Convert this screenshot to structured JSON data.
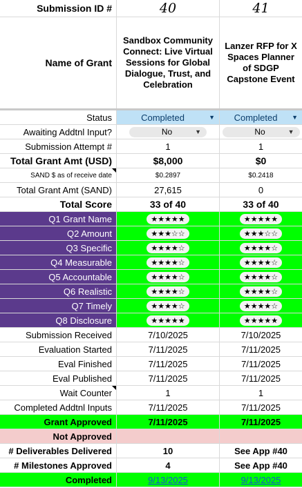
{
  "header": {
    "submission_id_label": "Submission ID #",
    "ids": [
      "40",
      "41"
    ],
    "name_label": "Name of Grant",
    "names": [
      "Sandbox Community Connect: Live Virtual Sessions for Global Dialogue, Trust, and Celebration",
      "Lanzer RFP for X Spaces Planner of SDGP Capstone Event"
    ]
  },
  "rows": {
    "status": {
      "label": "Status",
      "values": [
        "Completed",
        "Completed"
      ]
    },
    "awaiting": {
      "label": "Awaiting Addtnl Input?",
      "values": [
        "No",
        "No"
      ]
    },
    "attempt": {
      "label": "Submission Attempt #",
      "values": [
        "1",
        "1"
      ]
    },
    "total_usd": {
      "label": "Total Grant Amt (USD)",
      "values": [
        "$8,000",
        "$0"
      ]
    },
    "sand_rate": {
      "label": "SAND $ as of receive date",
      "values": [
        "$0.2897",
        "$0.2418"
      ]
    },
    "total_sand": {
      "label": "Total Grant Amt (SAND)",
      "values": [
        "27,615",
        "0"
      ]
    },
    "total_score": {
      "label": "Total Score",
      "values": [
        "33 of 40",
        "33 of 40"
      ]
    }
  },
  "questions": [
    {
      "label": "Q1 Grant Name",
      "values": [
        "★★★★★",
        "★★★★★"
      ]
    },
    {
      "label": "Q2 Amount",
      "values": [
        "★★★☆☆",
        "★★★☆☆"
      ]
    },
    {
      "label": "Q3 Specific",
      "values": [
        "★★★★☆",
        "★★★★☆"
      ]
    },
    {
      "label": "Q4 Measurable",
      "values": [
        "★★★★☆",
        "★★★★☆"
      ]
    },
    {
      "label": "Q5 Accountable",
      "values": [
        "★★★★☆",
        "★★★★☆"
      ]
    },
    {
      "label": "Q6 Realistic",
      "values": [
        "★★★★☆",
        "★★★★☆"
      ]
    },
    {
      "label": "Q7 Timely",
      "values": [
        "★★★★☆",
        "★★★★☆"
      ]
    },
    {
      "label": "Q8 Disclosure",
      "values": [
        "★★★★★",
        "★★★★★"
      ]
    }
  ],
  "dates": {
    "received": {
      "label": "Submission Received",
      "values": [
        "7/10/2025",
        "7/10/2025"
      ]
    },
    "eval_started": {
      "label": "Evaluation Started",
      "values": [
        "7/11/2025",
        "7/11/2025"
      ]
    },
    "eval_finished": {
      "label": "Eval Finished",
      "values": [
        "7/11/2025",
        "7/11/2025"
      ]
    },
    "eval_published": {
      "label": "Eval Published",
      "values": [
        "7/11/2025",
        "7/11/2025"
      ]
    },
    "wait_counter": {
      "label": "Wait Counter",
      "values": [
        "1",
        "1"
      ]
    },
    "completed_inputs": {
      "label": "Completed Addtnl Inputs",
      "values": [
        "7/11/2025",
        "7/11/2025"
      ]
    }
  },
  "outcomes": {
    "approved": {
      "label": "Grant Approved",
      "values": [
        "7/11/2025",
        "7/11/2025"
      ]
    },
    "not_approved": {
      "label": "Not Approved",
      "values": [
        "",
        ""
      ]
    },
    "deliverables": {
      "label": "# Deliverables Delivered",
      "values": [
        "10",
        "See App #40"
      ]
    },
    "milestones": {
      "label": "# Milestones Approved",
      "values": [
        "4",
        "See App #40"
      ]
    },
    "completed": {
      "label": "Completed",
      "values": [
        "9/13/2025",
        "9/13/2025"
      ]
    }
  },
  "colors": {
    "question_label_bg": "#5b3a8c",
    "approved_green": "#00ff00",
    "not_approved_pink": "#f4cccc",
    "status_blue": "#bfe1f6",
    "link_blue": "#1155cc"
  },
  "icons": {
    "dropdown": "chevron-down-icon"
  }
}
